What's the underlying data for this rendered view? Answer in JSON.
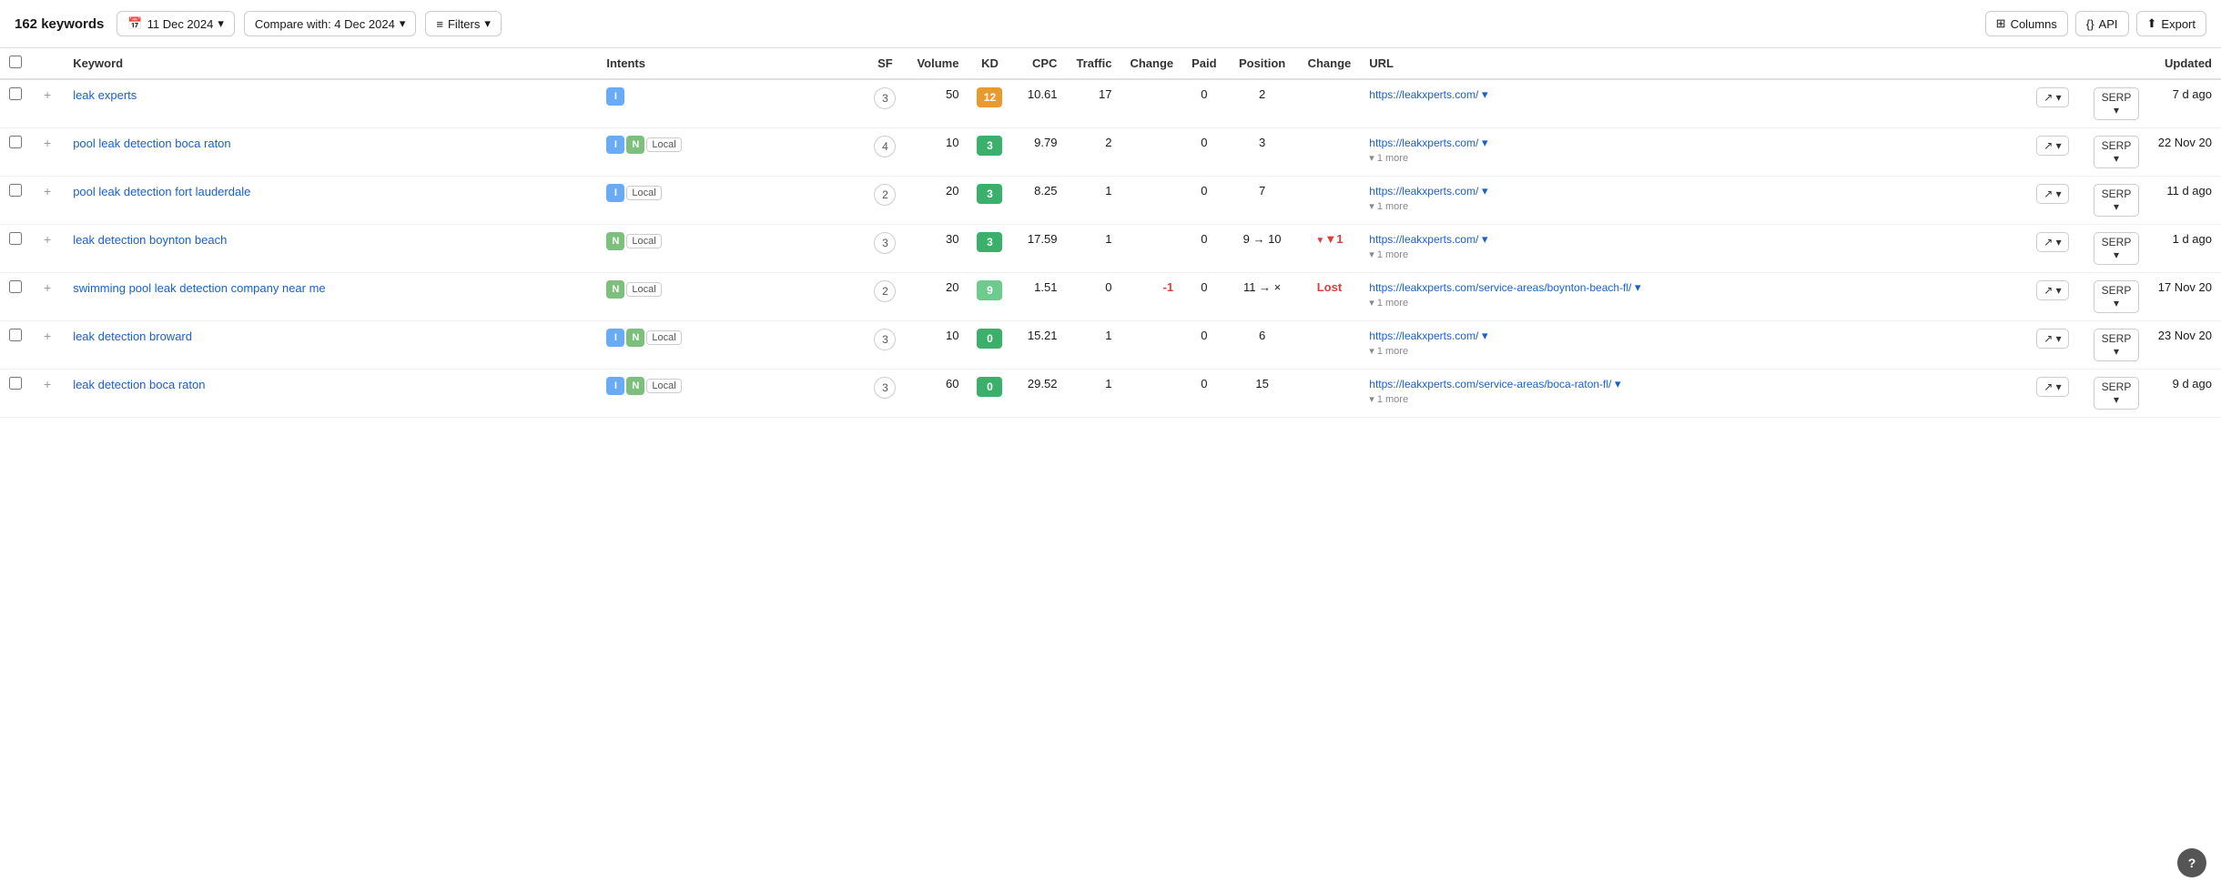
{
  "toolbar": {
    "keywords_count": "162 keywords",
    "date_label": "11 Dec 2024",
    "compare_label": "Compare with: 4 Dec 2024",
    "filters_label": "Filters",
    "columns_label": "Columns",
    "api_label": "API",
    "export_label": "Export"
  },
  "table": {
    "headers": [
      "",
      "",
      "Keyword",
      "Intents",
      "SF",
      "Volume",
      "KD",
      "CPC",
      "Traffic",
      "Change",
      "Paid",
      "Position",
      "Change",
      "URL",
      "",
      "",
      "Updated"
    ],
    "rows": [
      {
        "keyword": "leak experts",
        "keyword_url": "#",
        "intents": [
          {
            "type": "i",
            "label": "I"
          }
        ],
        "sf": "3",
        "volume": "50",
        "kd": "12",
        "kd_color": "orange",
        "cpc": "10.61",
        "traffic": "17",
        "change": "",
        "paid": "0",
        "position": "2",
        "position_change": "",
        "change2": "",
        "url": "https://leakxperts.com/",
        "url_more": false,
        "updated": "7 d ago"
      },
      {
        "keyword": "pool leak detection boca raton",
        "keyword_url": "#",
        "intents": [
          {
            "type": "i",
            "label": "I"
          },
          {
            "type": "n",
            "label": "N"
          },
          {
            "type": "local",
            "label": "Local"
          }
        ],
        "sf": "4",
        "volume": "10",
        "kd": "3",
        "kd_color": "green",
        "cpc": "9.79",
        "traffic": "2",
        "change": "",
        "paid": "0",
        "position": "3",
        "position_change": "",
        "change2": "",
        "url": "https://leakxperts.com/",
        "url_more": true,
        "updated": "22 Nov 20"
      },
      {
        "keyword": "pool leak detection fort lauderdale",
        "keyword_url": "#",
        "intents": [
          {
            "type": "i",
            "label": "I"
          },
          {
            "type": "local",
            "label": "Local"
          }
        ],
        "sf": "2",
        "volume": "20",
        "kd": "3",
        "kd_color": "green",
        "cpc": "8.25",
        "traffic": "1",
        "change": "",
        "paid": "0",
        "position": "7",
        "position_change": "",
        "change2": "",
        "url": "https://leakxperts.com/",
        "url_more": true,
        "updated": "11 d ago"
      },
      {
        "keyword": "leak detection boynton beach",
        "keyword_url": "#",
        "intents": [
          {
            "type": "n",
            "label": "N"
          },
          {
            "type": "local",
            "label": "Local"
          }
        ],
        "sf": "3",
        "volume": "30",
        "kd": "3",
        "kd_color": "green",
        "cpc": "17.59",
        "traffic": "1",
        "change": "",
        "paid": "0",
        "position": "9 → 10",
        "position_change": "▼1",
        "change2": "neg",
        "url": "https://leakxperts.com/",
        "url_more": true,
        "updated": "1 d ago"
      },
      {
        "keyword": "swimming pool leak detection company near me",
        "keyword_url": "#",
        "intents": [
          {
            "type": "n",
            "label": "N"
          },
          {
            "type": "local",
            "label": "Local"
          }
        ],
        "sf": "2",
        "volume": "20",
        "kd": "9",
        "kd_color": "light-green",
        "cpc": "1.51",
        "traffic": "0",
        "change": "-1",
        "change_type": "neg",
        "paid": "0",
        "position": "11 → ×",
        "position_change": "Lost",
        "change2": "lost",
        "url": "https://leakxperts.com/service-areas/boynton-beach-fl/",
        "url_more": true,
        "updated": "17 Nov 20"
      },
      {
        "keyword": "leak detection broward",
        "keyword_url": "#",
        "intents": [
          {
            "type": "i",
            "label": "I"
          },
          {
            "type": "n",
            "label": "N"
          },
          {
            "type": "local",
            "label": "Local"
          }
        ],
        "sf": "3",
        "volume": "10",
        "kd": "0",
        "kd_color": "zero",
        "cpc": "15.21",
        "traffic": "1",
        "change": "",
        "paid": "0",
        "position": "6",
        "position_change": "",
        "change2": "",
        "url": "https://leakxperts.com/",
        "url_more": true,
        "updated": "23 Nov 20"
      },
      {
        "keyword": "leak detection boca raton",
        "keyword_url": "#",
        "intents": [
          {
            "type": "i",
            "label": "I"
          },
          {
            "type": "n",
            "label": "N"
          },
          {
            "type": "local",
            "label": "Local"
          }
        ],
        "sf": "3",
        "volume": "60",
        "kd": "0",
        "kd_color": "zero",
        "cpc": "29.52",
        "traffic": "1",
        "change": "",
        "paid": "0",
        "position": "15",
        "position_change": "",
        "change2": "",
        "url": "https://leakxperts.com/service-areas/boca-raton-fl/",
        "url_more": true,
        "updated": "9 d ago"
      }
    ]
  },
  "help_btn": "?"
}
